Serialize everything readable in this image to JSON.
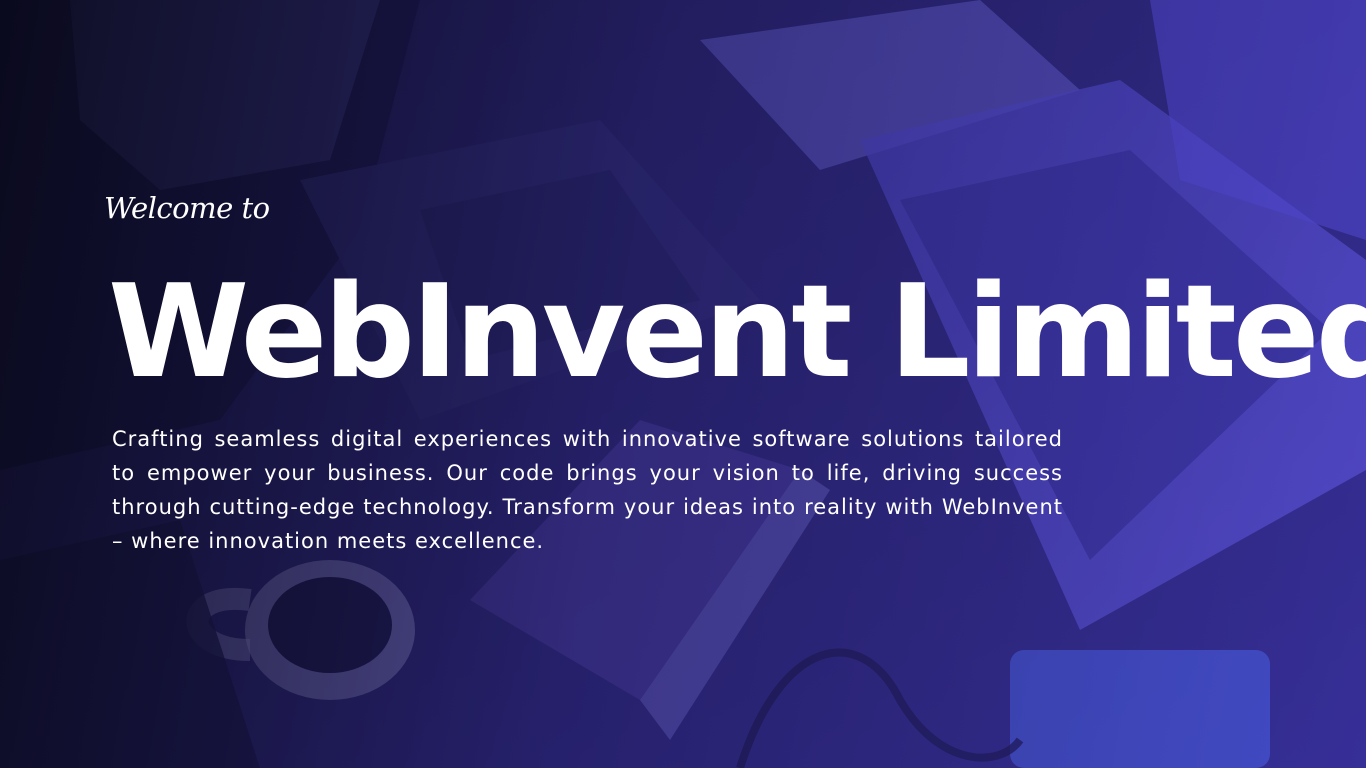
{
  "hero": {
    "welcome": "Welcome to",
    "title": "WebInvent Limited",
    "description": "Crafting seamless digital experiences with innovative software solutions tailored to empower your business. Our code brings your vision to life, driving success through cutting-edge technology. Transform your ideas into reality with WebInvent – where innovation meets excellence."
  },
  "colors": {
    "overlay": "#3b32c8",
    "text": "#ffffff",
    "dark": "#0e0d24"
  }
}
